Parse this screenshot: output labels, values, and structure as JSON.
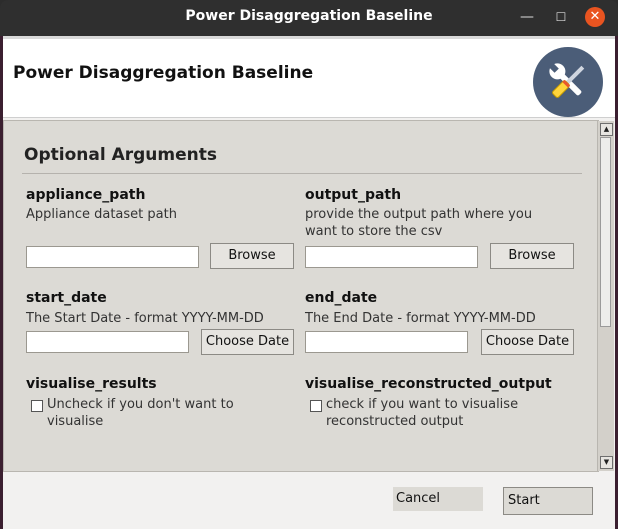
{
  "window": {
    "title": "Power Disaggregation Baseline"
  },
  "header": {
    "title": "Power Disaggregation Baseline",
    "logo_icon": "tools-icon"
  },
  "section": {
    "title": "Optional Arguments"
  },
  "fields": {
    "appliance_path": {
      "label": "appliance_path",
      "description": "Appliance dataset path",
      "value": "",
      "browse_label": "Browse"
    },
    "output_path": {
      "label": "output_path",
      "description_line1": "provide the output path where you",
      "description_line2": "want to store the csv",
      "value": "",
      "browse_label": "Browse"
    },
    "start_date": {
      "label": "start_date",
      "description": "The Start Date - format YYYY-MM-DD",
      "value": "",
      "button_label": "Choose Date"
    },
    "end_date": {
      "label": "end_date",
      "description": "The End Date - format YYYY-MM-DD",
      "value": "",
      "button_label": "Choose Date"
    },
    "visualise_results": {
      "label": "visualise_results",
      "checkbox_line1": "Uncheck if you don't want to",
      "checkbox_line2": "visualise",
      "checked": false
    },
    "visualise_reconstructed_output": {
      "label": "visualise_reconstructed_output",
      "checkbox_line1": "check if you want to visualise",
      "checkbox_line2": "reconstructed output",
      "checked": false
    }
  },
  "footer": {
    "cancel_label": "Cancel",
    "start_label": "Start"
  },
  "colors": {
    "close_button": "#e95420",
    "logo_bg": "#4b5d78",
    "panel_bg": "#dcdad5"
  }
}
